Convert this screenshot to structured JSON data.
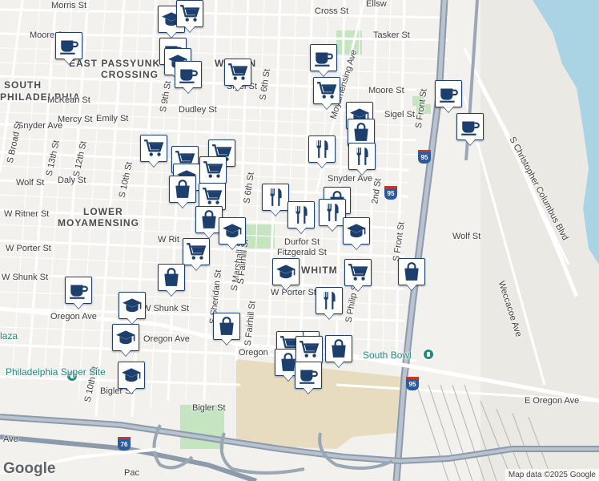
{
  "map": {
    "attribution": "Map data ©2025 Google",
    "logo": "Google",
    "colors": {
      "water": "#aad3e4",
      "park": "#c4e5c0",
      "highway": "#9aa7b5",
      "rail": "#a8a8a8",
      "marker_border": "#1d3f6e",
      "poi": "#1e8a7a",
      "shopping_area": "#e8dcc0"
    }
  },
  "areas": [
    {
      "text": "EAST PASSYUNK"
    },
    {
      "text": "CROSSING"
    },
    {
      "text": "WILTON"
    },
    {
      "text": "SOUTH"
    },
    {
      "text": "PHILADELPHIA"
    },
    {
      "text": "LOWER"
    },
    {
      "text": "MOYAMENSING"
    },
    {
      "text": "WHITM"
    }
  ],
  "streets": [
    "Morris St",
    "Moore St",
    "Cross St",
    "Tasker St",
    "Mercy St",
    "Emily St",
    "Dudley St",
    "McKean St",
    "Snyder Ave",
    "Snyder Ave",
    "Wolf St",
    "Daly St",
    "W Ritner St",
    "W Rit",
    "W Porter St",
    "W Shunk St",
    "W Shunk St",
    "Oregon Ave",
    "Oregon Ave",
    "Oregon",
    "Bigler St",
    "Bigler St",
    "S Broad St",
    "S 13th St",
    "S 12th St",
    "S 10th St",
    "S 10th St",
    "S 9th St",
    "S 6th St",
    "S 6th St",
    "S Marshall St",
    "S Sheridan St",
    "S Fairhill St",
    "S Fairhill St",
    "S Front St",
    "S Front St",
    "Sigel St",
    "Sigel St",
    "Moore St",
    "Wolf St",
    "Durfor St",
    "Fitzgerald St",
    "W Porter St",
    "S Christopher Columbus Blvd",
    "Weccacoe Ave",
    "Moyamensing Ave",
    "E Oregon Ave",
    "2nd St",
    "S Philip St",
    "Ave",
    "Pac",
    "Ellsw"
  ],
  "pois": [
    {
      "name": "South Bowl"
    },
    {
      "name": "Philadelphia Super Site"
    },
    {
      "name": "laza"
    }
  ],
  "shields": [
    "95",
    "95",
    "95",
    "76"
  ],
  "markers": [
    {
      "icon": "cafe"
    },
    {
      "icon": "school"
    },
    {
      "icon": "shopping-cart"
    },
    {
      "icon": "cafe"
    },
    {
      "icon": "school"
    },
    {
      "icon": "cafe"
    },
    {
      "icon": "shopping-cart"
    },
    {
      "icon": "cafe"
    },
    {
      "icon": "shopping-cart"
    },
    {
      "icon": "cafe"
    },
    {
      "icon": "cafe"
    },
    {
      "icon": "school"
    },
    {
      "icon": "shopping-bag"
    },
    {
      "icon": "restaurant"
    },
    {
      "icon": "restaurant"
    },
    {
      "icon": "shopping-cart"
    },
    {
      "icon": "shopping-cart"
    },
    {
      "icon": "shopping-cart"
    },
    {
      "icon": "school"
    },
    {
      "icon": "shopping-bag"
    },
    {
      "icon": "shopping-cart"
    },
    {
      "icon": "shopping-cart"
    },
    {
      "icon": "shopping-bag"
    },
    {
      "icon": "restaurant"
    },
    {
      "icon": "restaurant"
    },
    {
      "icon": "shopping-bag"
    },
    {
      "icon": "restaurant"
    },
    {
      "icon": "school"
    },
    {
      "icon": "shopping-cart"
    },
    {
      "icon": "school"
    },
    {
      "icon": "shopping-cart"
    },
    {
      "icon": "shopping-bag"
    },
    {
      "icon": "shopping-bag"
    },
    {
      "icon": "school"
    },
    {
      "icon": "shopping-cart"
    },
    {
      "icon": "cafe"
    },
    {
      "icon": "restaurant"
    },
    {
      "icon": "school"
    },
    {
      "icon": "shopping-bag"
    },
    {
      "icon": "school"
    },
    {
      "icon": "school"
    },
    {
      "icon": "shopping-cart"
    },
    {
      "icon": "shopping-bag"
    },
    {
      "icon": "shopping-cart"
    },
    {
      "icon": "shopping-bag"
    },
    {
      "icon": "cafe"
    }
  ]
}
